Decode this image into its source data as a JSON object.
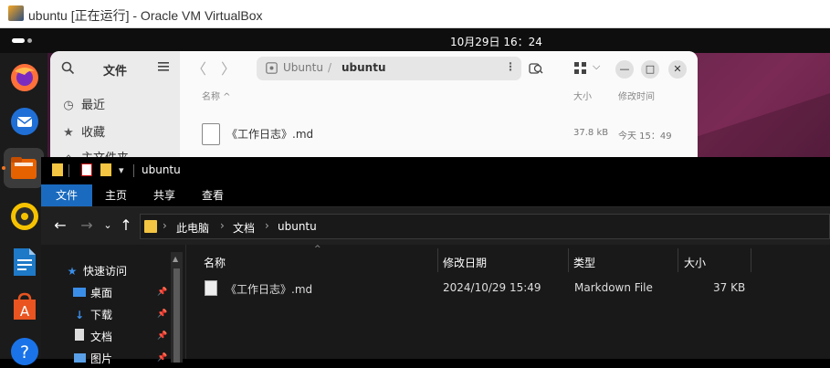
{
  "vbox": {
    "title": "ubuntu [正在运行] - Oracle VM VirtualBox"
  },
  "ubuntu_panel": {
    "clock": "10月29日  16：24"
  },
  "dock": {
    "apps": [
      {
        "name": "firefox-icon",
        "color": "#ff7139"
      },
      {
        "name": "thunderbird-icon",
        "color": "#1f6fd6"
      },
      {
        "name": "files-icon",
        "color": "#e66100"
      },
      {
        "name": "rhythmbox-icon",
        "color": "#f6c200"
      },
      {
        "name": "writer-icon",
        "color": "#1e79c7"
      },
      {
        "name": "app-center-icon",
        "color": "#e95420"
      },
      {
        "name": "help-icon",
        "color": "#1a73e8"
      }
    ]
  },
  "nautilus": {
    "sidebar": {
      "title": "文件",
      "items": [
        {
          "label": "最近",
          "icon": "clock-icon"
        },
        {
          "label": "收藏",
          "icon": "star-icon"
        },
        {
          "label": "主文件夹",
          "icon": "home-icon"
        }
      ]
    },
    "path": {
      "root": "Ubuntu",
      "separator": "/",
      "current": "ubuntu"
    },
    "columns": {
      "name": "名称",
      "size": "大小",
      "modified": "修改时间"
    },
    "file": {
      "name": "《工作日志》.md",
      "size": "37.8 kB",
      "modified": "今天 15：49"
    }
  },
  "explorer": {
    "title": "ubuntu",
    "ribbon_tabs": [
      "文件",
      "主页",
      "共享",
      "查看"
    ],
    "breadcrumb": [
      "此电脑",
      "文档",
      "ubuntu"
    ],
    "nav_items": [
      {
        "label": "快速访问",
        "icon": "star-icon"
      },
      {
        "label": "桌面",
        "icon": "desktop-icon",
        "pinned": true
      },
      {
        "label": "下载",
        "icon": "download-icon",
        "pinned": true
      },
      {
        "label": "文档",
        "icon": "document-icon",
        "pinned": true
      },
      {
        "label": "图片",
        "icon": "picture-icon",
        "pinned": true
      }
    ],
    "columns": {
      "name": "名称",
      "modified": "修改日期",
      "type": "类型",
      "size": "大小"
    },
    "file": {
      "name": "《工作日志》.md",
      "modified": "2024/10/29 15:49",
      "type": "Markdown File",
      "size": "37 KB"
    }
  }
}
